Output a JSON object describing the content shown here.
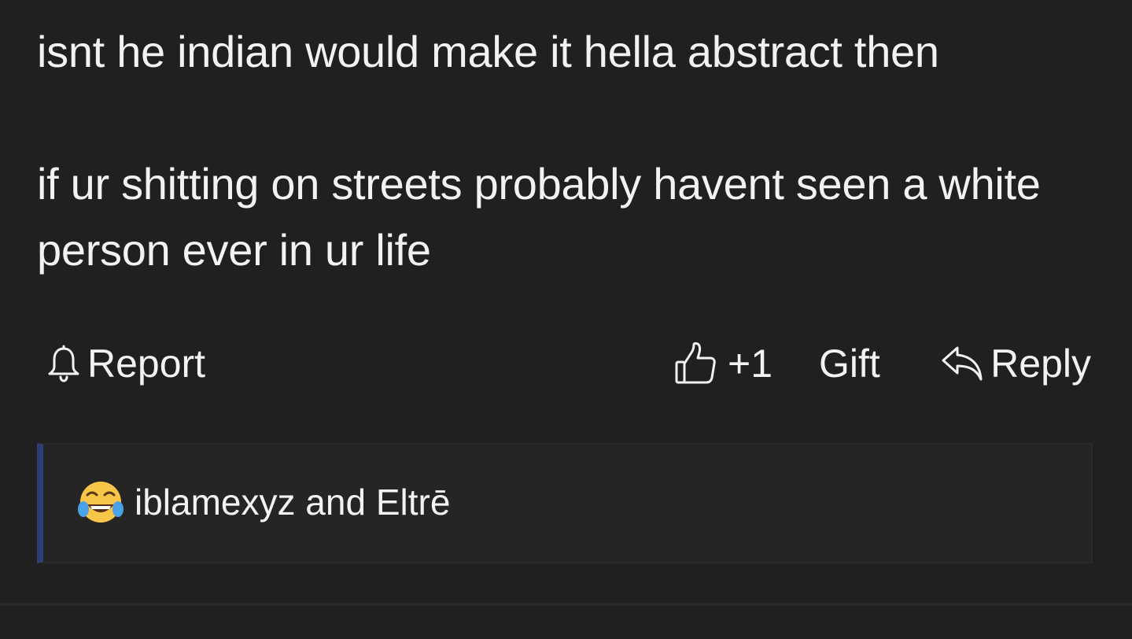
{
  "post": {
    "paragraph_1": "isnt he indian would make it hella abstract then",
    "paragraph_2": "if ur shitting on streets probably havent seen a white person ever in ur life"
  },
  "actions": {
    "report_label": "Report",
    "report_icon": "bell-icon",
    "like_count": "+1",
    "like_icon": "thumbs-up-icon",
    "gift_label": "Gift",
    "reply_label": "Reply",
    "reply_icon": "reply-arrow-icon"
  },
  "reactions": {
    "emoji": "tears-of-joy-emoji",
    "users_text": "iblamexyz and Eltrē"
  },
  "colors": {
    "background": "#202020",
    "reaction_panel": "#252525",
    "accent_bar": "#2d3e78",
    "text": "#f2f2f2"
  }
}
